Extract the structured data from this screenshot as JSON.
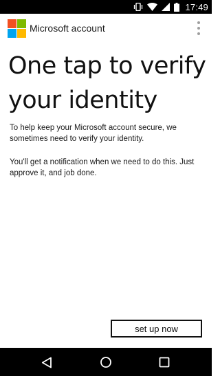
{
  "status_bar": {
    "time": "17:49",
    "icons": [
      "vibrate-icon",
      "wifi-icon",
      "signal-icon",
      "battery-icon"
    ]
  },
  "app_bar": {
    "title": "Microsoft account",
    "logo_colors": [
      "#f25022",
      "#7fba00",
      "#00a4ef",
      "#ffb900"
    ],
    "menu_icon": "overflow-menu-icon"
  },
  "main": {
    "headline": "One tap to verify your identity",
    "paragraph1": "To help keep your Microsoft account secure, we sometimes need to verify your identity.",
    "paragraph2": "You'll get a notification when we need to do this. Just approve it, and job done.",
    "setup_button_label": "set up now"
  },
  "nav_bar": {
    "buttons": [
      "back-icon",
      "home-icon",
      "recents-icon"
    ]
  }
}
